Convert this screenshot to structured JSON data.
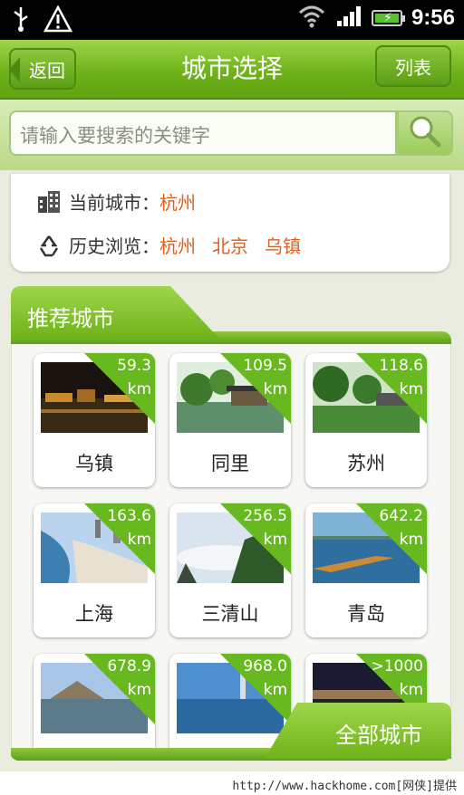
{
  "status_bar": {
    "time": "9:56"
  },
  "title_bar": {
    "back_label": "返回",
    "title": "城市选择",
    "list_label": "列表"
  },
  "search": {
    "placeholder": "请输入要搜索的关键字"
  },
  "current_city": {
    "label": "当前城市：",
    "city": "杭州"
  },
  "history": {
    "label": "历史浏览：",
    "cities": [
      "杭州",
      "北京",
      "乌镇"
    ]
  },
  "recommended": {
    "title": "推荐城市",
    "cities": [
      {
        "name": "乌镇",
        "distance": "59.3",
        "unit": "km"
      },
      {
        "name": "同里",
        "distance": "109.5",
        "unit": "km"
      },
      {
        "name": "苏州",
        "distance": "118.6",
        "unit": "km"
      },
      {
        "name": "上海",
        "distance": "163.6",
        "unit": "km"
      },
      {
        "name": "三清山",
        "distance": "256.5",
        "unit": "km"
      },
      {
        "name": "青岛",
        "distance": "642.2",
        "unit": "km"
      },
      {
        "name": "",
        "distance": "678.9",
        "unit": "km"
      },
      {
        "name": "",
        "distance": "968.0",
        "unit": "km"
      },
      {
        "name": "",
        "distance": ">1000",
        "unit": "km"
      }
    ]
  },
  "all_cities_label": "全部城市",
  "watermark": "http://www.hackhome.com[网侠]提供",
  "colors": {
    "accent": "#6eb319",
    "link": "#e35f1e"
  }
}
